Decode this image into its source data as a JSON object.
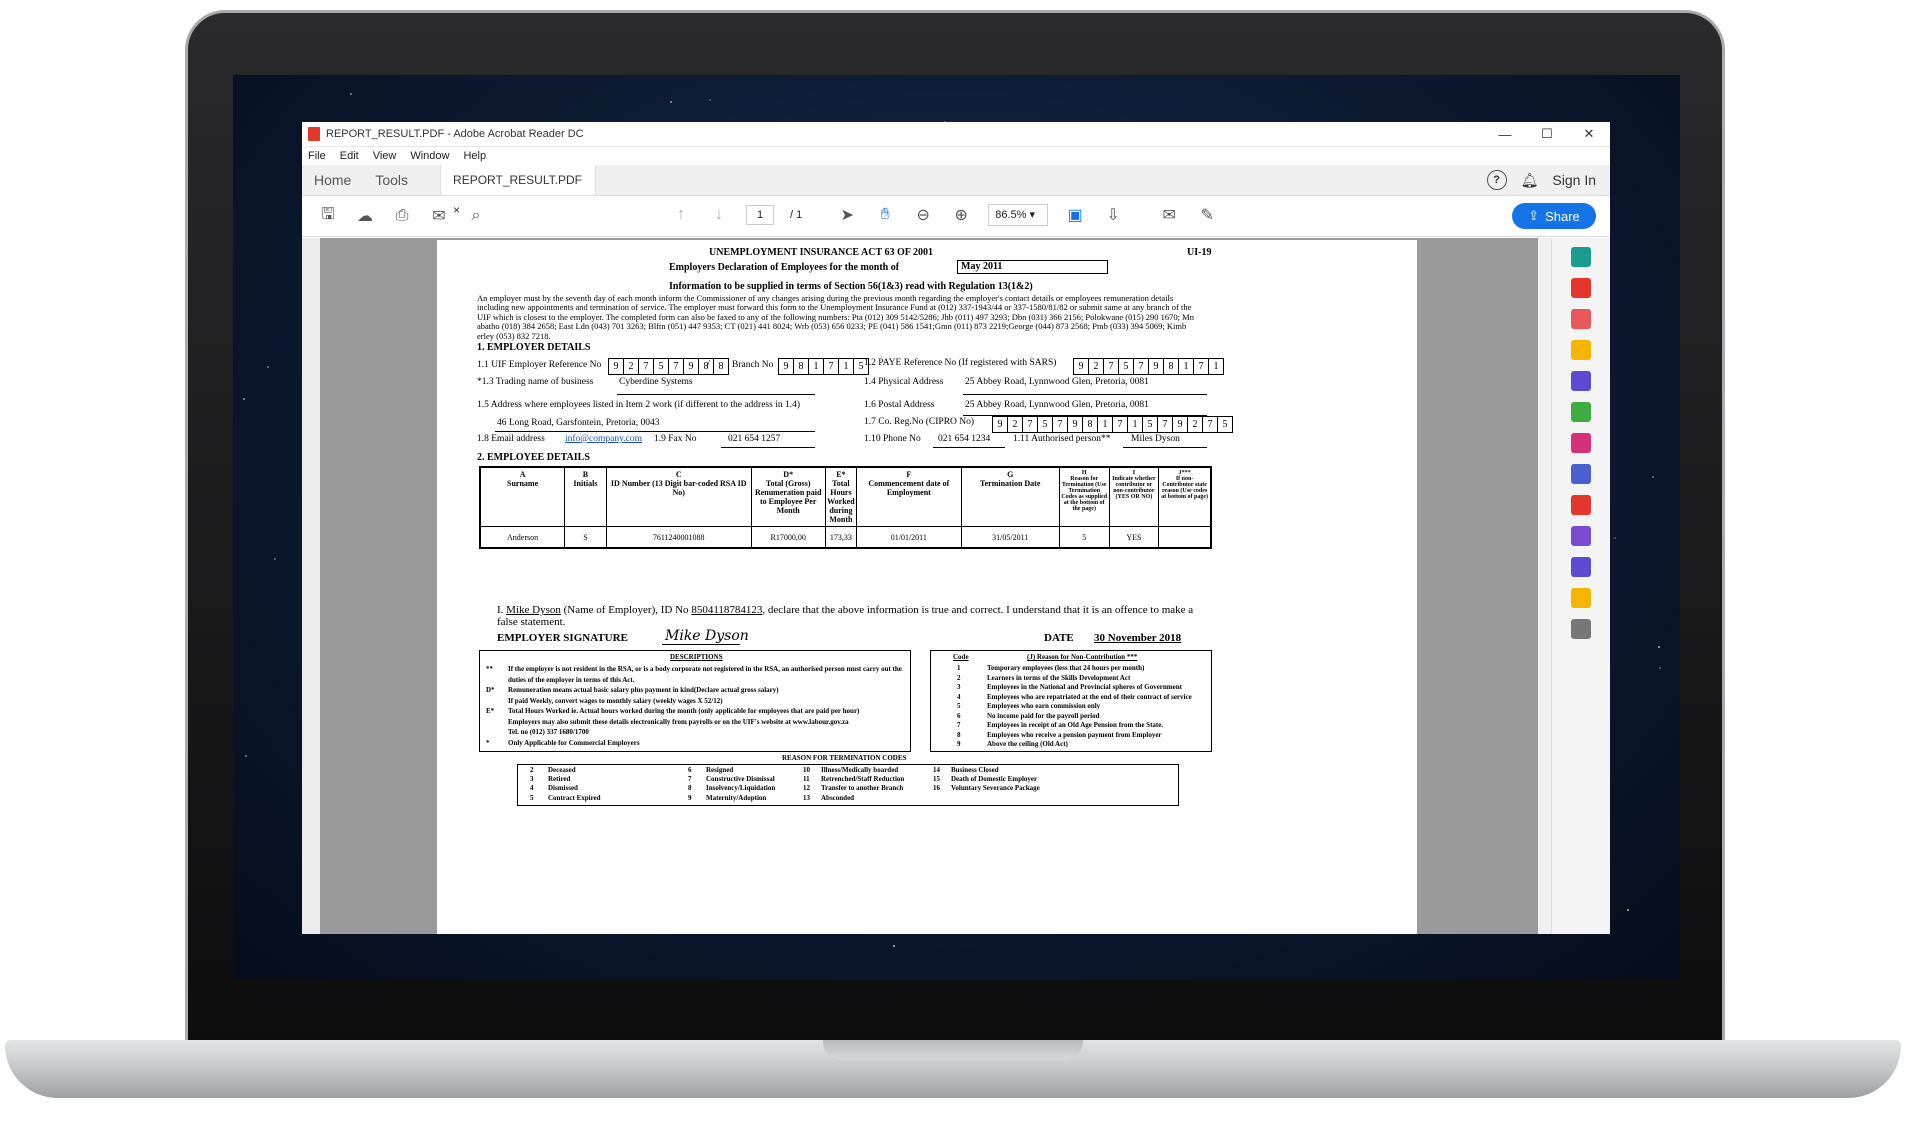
{
  "window": {
    "title": "REPORT_RESULT.PDF - Adobe Acrobat Reader DC",
    "controls": [
      "—",
      "☐",
      "✕"
    ]
  },
  "menu": [
    "File",
    "Edit",
    "View",
    "Window",
    "Help"
  ],
  "tabs": {
    "home": "Home",
    "tools": "Tools",
    "document": "REPORT_RESULT.PDF",
    "close": "×",
    "sign_in": "Sign In",
    "help": "?"
  },
  "toolbar": {
    "page_current": "1",
    "page_total": "/ 1",
    "zoom": "86.5%",
    "zoom_caret": "▾",
    "share": "Share"
  },
  "form": {
    "act_title": "UNEMPLOYMENT INSURANCE ACT 63 OF 2001",
    "form_code": "UI-19",
    "declaration_label": "Employers Declaration of Employees for the month of",
    "month": "May 2011",
    "info_title": "Information to be supplied in terms of Section 56(1&3) read with Regulation 13(1&2)",
    "intro_lines": [
      "An employer must by the seventh day of each month inform the Commissioner of any changes arising during the previous month regarding the employer's contact details or employees remuneration details",
      "including new appointments and termination of service.  The employer must forward this form to the Unemployment Insurance Fund at (012) 337-1943/44 or 337-1580/81/82 or submit same at any branch of the",
      "UIF which is closest to the employer. The completed form can also be faxed to any of the following numbers: Pta (012) 309 5142/5286; Jhb (011) 497 3293; Dbn (031) 366 2156; Polokwane (015) 290 1670; Mn",
      "abatho (018) 384 2658; East Ldn (043) 701 3263; Blftn (051) 447 9353; CT (021) 441 8024; Wrb (053) 656 0233; PE (041) 586 1541;Gmn (011) 873 2219;George (044) 873 2568; Pmb (033) 394 5069; Kimb",
      "erley (053) 832 7218."
    ],
    "section1": "1. EMPLOYER DETAILS",
    "f1_1_label": "1.1  UIF Employer Reference No",
    "uif_ref_digits": [
      "9",
      "2",
      "7",
      "5",
      "7",
      "9",
      "8"
    ],
    "uif_ref_sep": "/",
    "uif_ref_check": [
      "8"
    ],
    "branch_label": "Branch No",
    "branch_digits": [
      "9",
      "8",
      "1",
      "7",
      "1",
      "5"
    ],
    "f1_2_label": "1.2  PAYE Reference No (If registered with SARS)",
    "paye_digits": [
      "9",
      "2",
      "7",
      "5",
      "7",
      "9",
      "8",
      "1",
      "7",
      "1"
    ],
    "f1_3_label": "*1.3  Trading name of business",
    "trading_name": "Cyberdine Systems",
    "f1_4_label": "1.4  Physical Address",
    "physical_address": "25 Abbey Road, Lynnwood Glen, Pretoria, 0081",
    "f1_5_label": "1.5  Address where employees listed in Item 2 work (if different to the address in 1.4)",
    "work_address": "46 Long Road, Garsfontein, Pretoria, 0043",
    "f1_6_label": "1.6  Postal Address",
    "postal_address": "25 Abbey Road, Lynnwood Glen, Pretoria, 0081",
    "f1_7_label": "1.7  Co. Reg.No (CIPRO No)",
    "coreg_digits": [
      "9",
      "2",
      "7",
      "5",
      "7",
      "9",
      "8",
      "1",
      "7",
      "1",
      "5",
      "7",
      "9",
      "2",
      "7",
      "5"
    ],
    "f1_8_label": "1.8  Email address",
    "email": "info@company.com",
    "f1_9_label": "1.9  Fax No",
    "fax": "021 654 1257",
    "f1_10_label": "1.10  Phone No",
    "phone": "021 654 1234",
    "f1_11_label": "1.11  Authorised person**",
    "authorised_person": "Miles Dyson",
    "section2": "2. EMPLOYEE DETAILS",
    "columns": [
      {
        "letter": "A",
        "title": "Surname"
      },
      {
        "letter": "B",
        "title": "Initials"
      },
      {
        "letter": "C",
        "title": "ID Number (13 Digit bar-coded RSA ID No)"
      },
      {
        "letter": "D*",
        "title": "Total (Gross) Renumeration paid to Employee Per Month"
      },
      {
        "letter": "E*",
        "title": "Total Hours Worked during Month"
      },
      {
        "letter": "F",
        "title": "Commencement date of Employment"
      },
      {
        "letter": "G",
        "title": "Termination Date"
      },
      {
        "letter": "H",
        "title": "Reason for Termination (Use Termination Codes as supplied at the bottom of the page)"
      },
      {
        "letter": "I",
        "title": "Indicate whether contributor or non-contributor (YES OR NO)"
      },
      {
        "letter": "J***",
        "title": "If non-Contributor state reason (Use codes at bottom of page)"
      }
    ],
    "employee_row": [
      "Anderson",
      "S",
      "7611240001088",
      "R17000,00",
      "173,33",
      "01/01/2011",
      "31/05/2011",
      "5",
      "YES",
      ""
    ],
    "decl_i": "I.",
    "decl_name": "Mike Dyson",
    "decl_mid": "(Name of Employer), ID No",
    "decl_id": "8504118784123",
    "decl_rest": ", declare that the above information is true and correct.  I understand that it is an offence to make a",
    "decl_line2": "false statement.",
    "signature_label": "EMPLOYER SIGNATURE",
    "signature": "Mike Dyson",
    "date_label": "DATE",
    "date_value": "30 November 2018",
    "descriptions_title": "DESCRIPTIONS",
    "descriptions": [
      {
        "mark": "**",
        "text": "If the employer is not resident in the RSA, or is a body corporate not registered in the RSA, an authorised person must carry out the"
      },
      {
        "mark": "",
        "text": "duties of the employer in terms of this Act."
      },
      {
        "mark": "D*",
        "text": "Remuneration means actual basic salary plus payment in kind(Declare actual gross salary)"
      },
      {
        "mark": "",
        "text": "If paid Weekly, convert wages to monthly salary  (weekly wages X 52/12)"
      },
      {
        "mark": "E*",
        "text": "Total Hours Worked ie.  Actual hours worked during the month (only applicable for employees that are paid per hour)"
      },
      {
        "mark": "",
        "text": "Employers may also submit these details electronically from payrolls or on the UIF's website at www.labour.gov.za"
      },
      {
        "mark": "",
        "text": "Tel. no (012) 337 1680/1700"
      },
      {
        "mark": "*",
        "text": "Only Applicable for Commercial Employers"
      }
    ],
    "code_header": "Code",
    "noncontrib_header": "(J) Reason for Non-Contribution ***",
    "noncontrib": [
      {
        "code": "1",
        "text": "Temporary employees (less that 24 hours per month)"
      },
      {
        "code": "2",
        "text": "Learners in terms of the Skills Development Act"
      },
      {
        "code": "3",
        "text": "Employees in the National and Provincial spheres of Government"
      },
      {
        "code": "4",
        "text": "Employees who are repatriated at the end of their contract of service"
      },
      {
        "code": "5",
        "text": "Employees who earn commission only"
      },
      {
        "code": "6",
        "text": "No income paid for the payroll period"
      },
      {
        "code": "7",
        "text": "Employees in receipt of an Old Age Pension from the State."
      },
      {
        "code": "8",
        "text": "Employees who receive a pension payment from Employer"
      },
      {
        "code": "9",
        "text": "Above the ceiling (Old Act)"
      }
    ],
    "termination_title": "REASON FOR TERMINATION CODES",
    "termination_cols": [
      [
        {
          "code": "2",
          "text": "Deceased"
        },
        {
          "code": "3",
          "text": "Retired"
        },
        {
          "code": "4",
          "text": "Dismissed"
        },
        {
          "code": "5",
          "text": "Contract Expired"
        }
      ],
      [
        {
          "code": "6",
          "text": "Resigned"
        },
        {
          "code": "7",
          "text": "Constructive Dismissal"
        },
        {
          "code": "8",
          "text": "Insolvency/Liquidation"
        },
        {
          "code": "9",
          "text": "Maternity/Adoption"
        }
      ],
      [
        {
          "code": "10",
          "text": "Illness/Medically boarded"
        },
        {
          "code": "11",
          "text": "Retrenched/Staff Reduction"
        },
        {
          "code": "12",
          "text": "Transfer to another Branch"
        },
        {
          "code": "13",
          "text": "Absconded"
        }
      ],
      [
        {
          "code": "14",
          "text": "Business Closed"
        },
        {
          "code": "15",
          "text": "Death of Domestic Employer"
        },
        {
          "code": "16",
          "text": "Voluntary Severance Package"
        }
      ]
    ]
  },
  "icons": {
    "toolbar": [
      "save-icon",
      "upload-icon",
      "print-icon",
      "email-icon",
      "search-icon",
      "page-up-icon",
      "page-down-icon",
      "select-icon",
      "hand-icon",
      "zoom-out-icon",
      "zoom-in-icon",
      "fit-page-icon",
      "scroll-mode-icon",
      "comment-icon",
      "highlight-icon"
    ],
    "right_panel": [
      "export-pdf-icon",
      "create-pdf-icon",
      "organize-pages-icon",
      "comment-tool-icon",
      "combine-files-icon",
      "compress-icon",
      "fill-sign-icon",
      "protect-icon",
      "pdf-convert-icon",
      "edit-pdf-icon",
      "send-signature-icon",
      "stamp-icon",
      "more-tools-icon"
    ]
  },
  "colors": {
    "accent": "#1473e6",
    "pdf_red": "#e4362a"
  }
}
